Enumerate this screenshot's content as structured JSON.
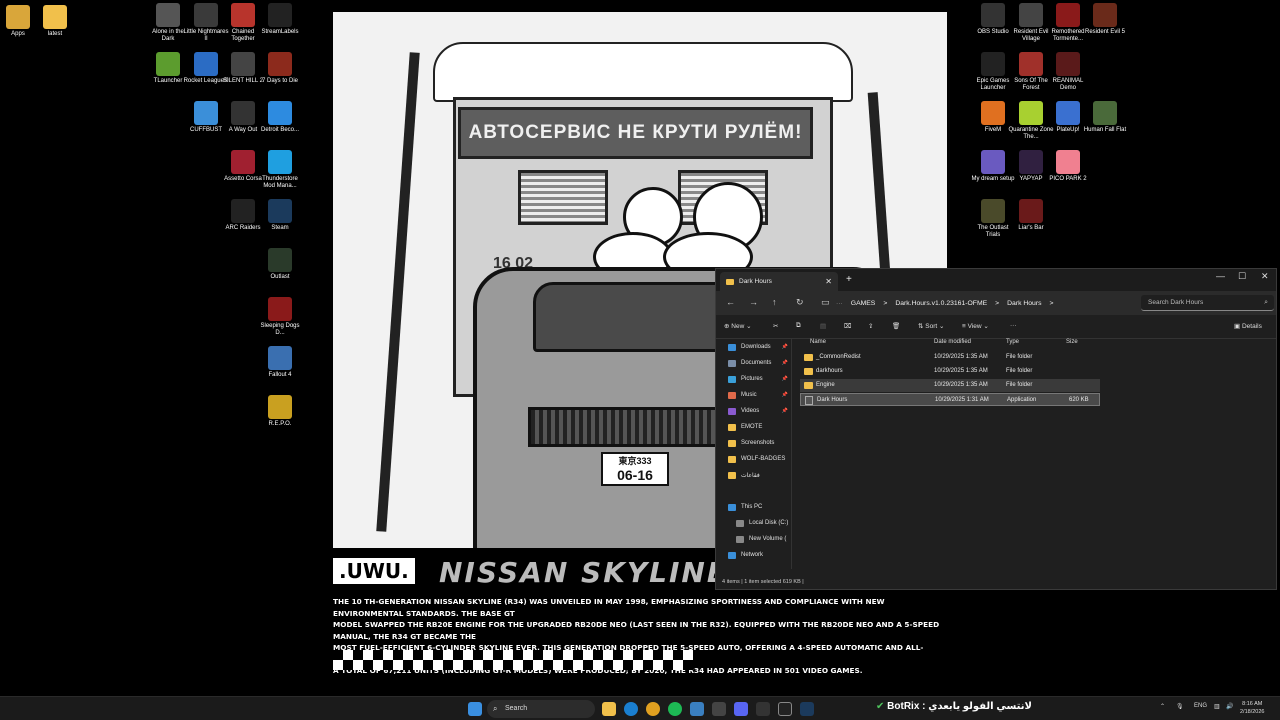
{
  "desktop_left": [
    {
      "label": "Apps",
      "color": "#d9a63a"
    },
    {
      "label": "latest",
      "color": "#f1c04b"
    }
  ],
  "desktop_mid": [
    {
      "label": "Alone in the Dark",
      "color": "#555"
    },
    {
      "label": "Little Nightmares II",
      "color": "#3a3a3a"
    },
    {
      "label": "Chained Together",
      "color": "#b8342c"
    },
    {
      "label": "StreamLabels",
      "color": "#222"
    },
    {
      "label": "TLauncher",
      "color": "#5c9c2e"
    },
    {
      "label": "Rocket League®",
      "color": "#2b6cc4"
    },
    {
      "label": "SILENT HILL 2",
      "color": "#444"
    },
    {
      "label": "7 Days to Die",
      "color": "#8c2a1c"
    },
    {
      "label": "CUFFBUST",
      "color": "#3b8fd9"
    },
    {
      "label": "A Way Out",
      "color": "#333"
    },
    {
      "label": "Detroit Beco...",
      "color": "#2d8be0"
    },
    {
      "label": "Assetto Corsa",
      "color": "#a02030"
    },
    {
      "label": "Thunderstore Mod Mana...",
      "color": "#1f9fe0"
    },
    {
      "label": "ARC Raiders",
      "color": "#222"
    },
    {
      "label": "Steam",
      "color": "#1b3a5c"
    },
    {
      "label": "Outlast",
      "color": "#2a3a2a"
    },
    {
      "label": "Sleeping Dogs D...",
      "color": "#8a1a1a"
    },
    {
      "label": "Fallout 4",
      "color": "#3a6fb0"
    },
    {
      "label": "R.E.P.O.",
      "color": "#c9a020"
    }
  ],
  "desktop_right": [
    {
      "label": "OBS Studio",
      "color": "#333"
    },
    {
      "label": "Resident Evil Village",
      "color": "#444"
    },
    {
      "label": "Remothered Tormente...",
      "color": "#8a1a1a"
    },
    {
      "label": "Resident Evil 5",
      "color": "#6a2a1a"
    },
    {
      "label": "Epic Games Launcher",
      "color": "#222"
    },
    {
      "label": "Sons Of The Forest",
      "color": "#a0302a"
    },
    {
      "label": "REANIMAL Demo",
      "color": "#5a1a1a"
    },
    {
      "label": "FiveM",
      "color": "#e07020"
    },
    {
      "label": "Quarantine Zone The...",
      "color": "#a8d030"
    },
    {
      "label": "PlateUp!",
      "color": "#3a70d0"
    },
    {
      "label": "Human Fall Flat",
      "color": "#4a6a3a"
    },
    {
      "label": "My dream setup",
      "color": "#6a5ac0"
    },
    {
      "label": "YAPYAP",
      "color": "#302040"
    },
    {
      "label": "PICO PARK 2",
      "color": "#f08090"
    },
    {
      "label": "The Outlast Trials",
      "color": "#4a4a2a"
    },
    {
      "label": "Liar's Bar",
      "color": "#6a1a1a"
    }
  ],
  "poster": {
    "sign": "АВТОСЕРВИС НЕ КРУТИ РУЛЁМ!",
    "wall_number": "16 02",
    "plate_top": "東京333",
    "plate_bottom": "06-16",
    "brand": ".UWU.",
    "car_name": "NISSAN SKYLINE GT",
    "desc": [
      "THE 10 TH-GENERATION NISSAN SKYLINE (R34) WAS UNVEILED IN MAY 1998, EMPHASIZING SPORTINESS AND COMPLIANCE WITH NEW ENVIRONMENTAL STANDARDS. THE BASE GT",
      "MODEL SWAPPED THE RB20E ENGINE FOR THE UPGRADED RB20DE NEO (LAST SEEN IN THE R32). EQUIPPED WITH THE RB20DE NEO AND A 5-SPEED MANUAL, THE R34 GT BECAME THE",
      "MOST FUEL-EFFICIENT 6-CYLINDER SKYLINE EVER. THIS GENERATION DROPPED THE 5-SPEED AUTO, OFFERING A 4-SPEED AUTOMATIC AND ALL-WHEEL DRIVE INSTEAD.",
      "A TOTAL OF 67,211 UNITS (INCLUDING GT-R MODELS) WERE PRODUCED; BY 2020, THE R34 HAD APPEARED IN 501 VIDEO GAMES."
    ]
  },
  "explorer": {
    "tab_title": "Dark Hours",
    "breadcrumbs": [
      "GAMES",
      ">",
      "Dark.Hours.v1.0.23161-OFME",
      ">",
      "Dark Hours",
      ">"
    ],
    "search_placeholder": "Search Dark Hours",
    "cmd": {
      "new": "New",
      "sort": "Sort",
      "view": "View",
      "more": "···",
      "details": "Details"
    },
    "nav_items": [
      {
        "label": "Downloads",
        "color": "#3a8fd9",
        "pin": true
      },
      {
        "label": "Documents",
        "color": "#7a8ea8",
        "pin": true
      },
      {
        "label": "Pictures",
        "color": "#3aa0d9",
        "pin": true
      },
      {
        "label": "Music",
        "color": "#e06a4a",
        "pin": true
      },
      {
        "label": "Videos",
        "color": "#8a5ad0",
        "pin": true
      },
      {
        "label": "EMOTE",
        "color": "#f1c04b",
        "pin": false
      },
      {
        "label": "Screenshots",
        "color": "#f1c04b",
        "pin": false
      },
      {
        "label": "WOLF-BADGES",
        "color": "#f1c04b",
        "pin": false
      },
      {
        "label": "فقاعات",
        "color": "#f1c04b",
        "pin": false
      },
      {
        "label": "This PC",
        "color": "#3a8fd9",
        "pin": false
      },
      {
        "label": "Local Disk (C:)",
        "color": "#888",
        "pin": false
      },
      {
        "label": "New Volume (",
        "color": "#888",
        "pin": false
      },
      {
        "label": "Network",
        "color": "#3a8fd9",
        "pin": false
      }
    ],
    "columns": {
      "name": "Name",
      "date": "Date modified",
      "type": "Type",
      "size": "Size"
    },
    "files": [
      {
        "name": "_CommonRedist",
        "date": "10/29/2025 1:35 AM",
        "type": "File folder",
        "size": ""
      },
      {
        "name": "darkhours",
        "date": "10/29/2025 1:35 AM",
        "type": "File folder",
        "size": ""
      },
      {
        "name": "Engine",
        "date": "10/29/2025 1:35 AM",
        "type": "File folder",
        "size": ""
      },
      {
        "name": "Dark Hours",
        "date": "10/29/2025 1:31 AM",
        "type": "Application",
        "size": "620 KB"
      }
    ],
    "status": "4 items  |  1 item selected  619 KB  |"
  },
  "taskbar": {
    "search": "Search",
    "botrix_text": "BotRix : لانتسي الفولو يابعدي",
    "lang": "ENG",
    "time": "8:16 AM",
    "date": "2/18/2026"
  }
}
